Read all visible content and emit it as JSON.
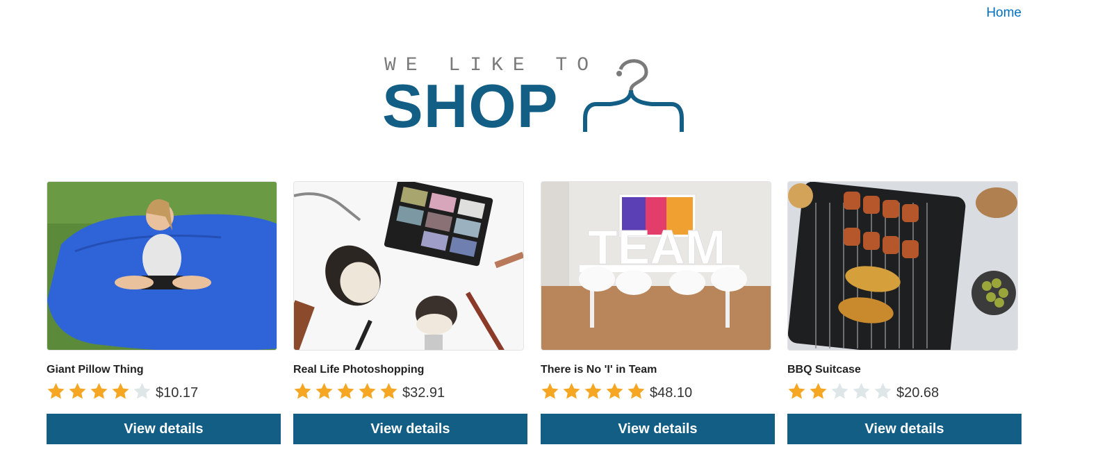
{
  "nav": {
    "home_label": "Home"
  },
  "logo": {
    "small_text": "WE LIKE TO",
    "big_text": "SHOP"
  },
  "colors": {
    "brand": "#135e85",
    "link": "#0071c1",
    "star_on": "#f5a623",
    "star_off": "#dfe6e8"
  },
  "products": [
    {
      "name": "Giant Pillow Thing",
      "rating": 4,
      "max_rating": 5,
      "price": "$10.17",
      "button_label": "View details",
      "image": "blue-beanbag-photo"
    },
    {
      "name": "Real Life Photoshopping",
      "rating": 5,
      "max_rating": 5,
      "price": "$32.91",
      "button_label": "View details",
      "image": "makeup-brushes-photo"
    },
    {
      "name": "There is No 'I' in Team",
      "rating": 5,
      "max_rating": 5,
      "price": "$48.10",
      "button_label": "View details",
      "image": "team-meeting-room-photo"
    },
    {
      "name": "BBQ Suitcase",
      "rating": 2,
      "max_rating": 5,
      "price": "$20.68",
      "button_label": "View details",
      "image": "bbq-grill-photo"
    }
  ]
}
